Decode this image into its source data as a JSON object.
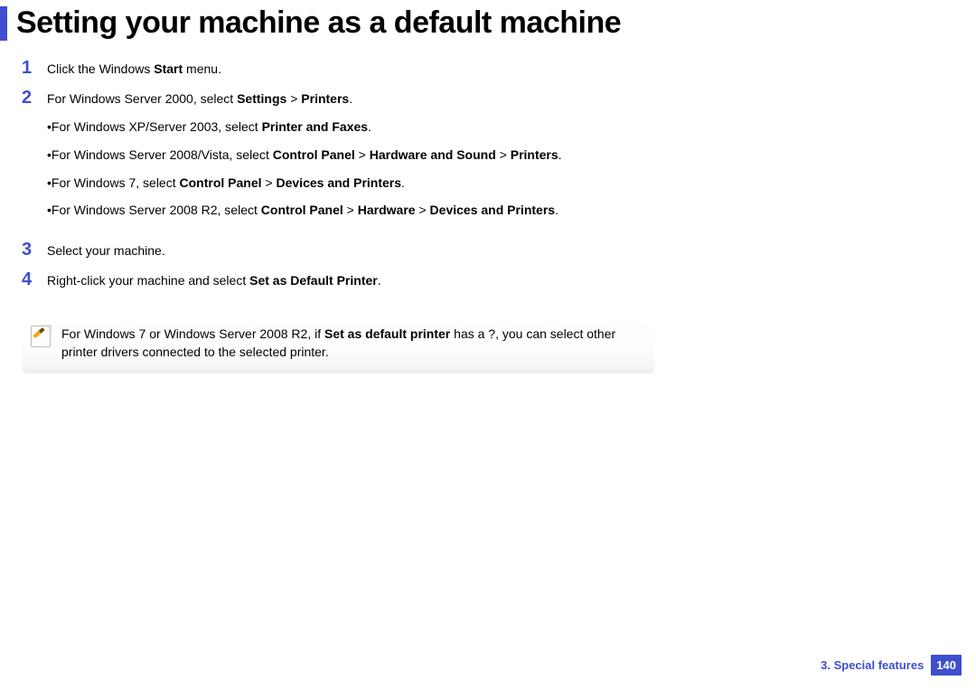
{
  "title": "Setting your machine as a default machine",
  "steps": {
    "s1": {
      "num": "1",
      "pre": "Click the Windows ",
      "bold": "Start",
      "post": " menu."
    },
    "s2": {
      "num": "2",
      "pre": "For Windows Server 2000, select ",
      "bold_a": "Settings",
      "gt_1": " > ",
      "bold_b": "Printers",
      "post": ".",
      "sub1": {
        "pre": "•For Windows XP/Server 2003, select ",
        "bold": "Printer and Faxes",
        "post": "."
      },
      "sub2": {
        "pre": "•For Windows Server 2008/Vista, select ",
        "bold_a": "Control Panel",
        "gt_1": " > ",
        "bold_b": "Hardware and Sound",
        "gt_2": " > ",
        "bold_c": "Printers",
        "post": "."
      },
      "sub3": {
        "pre": "•For Windows 7, select ",
        "bold_a": "Control Panel",
        "gt_1": " > ",
        "bold_b": "Devices and Printers",
        "post": "."
      },
      "sub4": {
        "pre": "•For Windows Server 2008 R2, select ",
        "bold_a": "Control Panel",
        "gt_1": " > ",
        "bold_b": "Hardware",
        "gt_2": " > ",
        "bold_c": "Devices and Printers",
        "post": "."
      }
    },
    "s3": {
      "num": "3",
      "text": "Select your machine."
    },
    "s4": {
      "num": "4",
      "pre": "Right-click your machine and select ",
      "bold": "Set as Default Printer",
      "post": "."
    }
  },
  "note": {
    "pre": "For Windows 7 or Windows Server 2008 R2, if ",
    "bold": "Set as default printer",
    "post": " has a ?, you can select other printer drivers connected to the selected printer."
  },
  "footer": {
    "section": "3.  Special features",
    "page": "140"
  }
}
